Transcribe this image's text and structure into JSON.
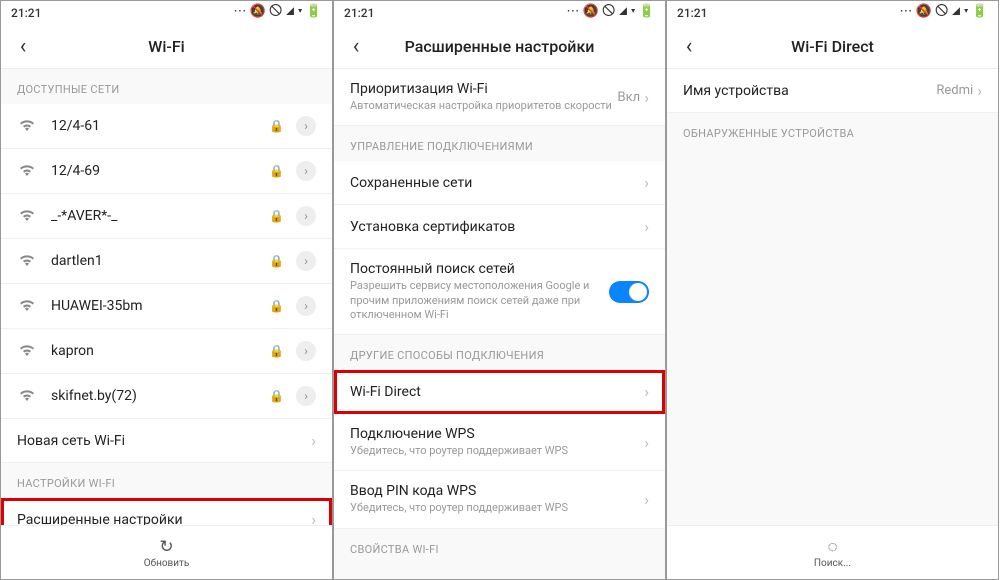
{
  "status_time": "21:21",
  "status_icons": "⋯ 🔕 🛇 ◢ ▾ 🔋",
  "screen1": {
    "title": "Wi-Fi",
    "section_available": "ДОСТУПНЫЕ СЕТИ",
    "networks": [
      {
        "name": "12/4-61"
      },
      {
        "name": "12/4-69"
      },
      {
        "name": "_-*AVER*-_"
      },
      {
        "name": "dartlen1"
      },
      {
        "name": "HUAWEI-35bm"
      },
      {
        "name": "kapron"
      },
      {
        "name": "skifnet.by(72)"
      }
    ],
    "new_network": "Новая сеть Wi-Fi",
    "section_settings": "НАСТРОЙКИ WI-FI",
    "advanced": "Расширенные настройки",
    "footer": "Обновить"
  },
  "screen2": {
    "title": "Расширенные настройки",
    "priority": {
      "title": "Приоритизация Wi-Fi",
      "sub": "Автоматическая настройка приоритетов скорости",
      "value": "Вкл"
    },
    "section_conn": "УПРАВЛЕНИЕ ПОДКЛЮЧЕНИЯМИ",
    "saved_networks": "Сохраненные сети",
    "install_certs": "Установка сертификатов",
    "scan": {
      "title": "Постоянный поиск сетей",
      "sub": "Разрешить сервису местоположения Google и прочим приложениям поиск сетей даже при отключенном Wi-Fi"
    },
    "section_other": "ДРУГИЕ СПОСОБЫ ПОДКЛЮЧЕНИЯ",
    "wifi_direct": "Wi-Fi Direct",
    "wps": {
      "title": "Подключение WPS",
      "sub": "Убедитесь, что роутер поддерживает WPS"
    },
    "wps_pin": {
      "title": "Ввод PIN кода WPS",
      "sub": "Убедитесь, что роутер поддерживает WPS"
    },
    "section_props": "СВОЙСТВА WI-FI"
  },
  "screen3": {
    "title": "Wi-Fi Direct",
    "device_name_label": "Имя устройства",
    "device_name_value": "Redmi",
    "section_discovered": "ОБНАРУЖЕННЫЕ УСТРОЙСТВА",
    "footer": "Поиск..."
  }
}
